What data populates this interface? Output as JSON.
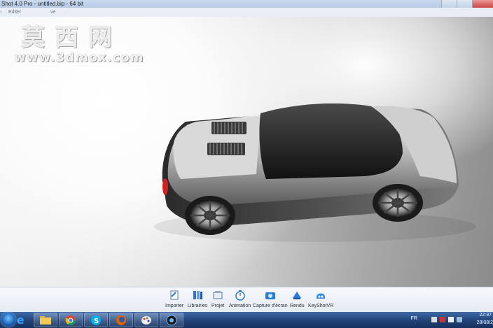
{
  "window": {
    "title": "Shot 4.0 Pro - untitled.bip - 64 bit"
  },
  "menu": {
    "items": [
      "Editer",
      "ve"
    ]
  },
  "watermark": {
    "chinese": "莫西网",
    "url": "www.3dmox.com"
  },
  "toolbar": {
    "items": [
      {
        "label": "Importer",
        "icon": "import-icon"
      },
      {
        "label": "Librairies",
        "icon": "library-icon"
      },
      {
        "label": "Projet",
        "icon": "project-icon"
      },
      {
        "label": "Animation",
        "icon": "animation-icon"
      },
      {
        "label": "Capture d'écran",
        "icon": "screenshot-icon"
      },
      {
        "label": "Rendu",
        "icon": "render-icon"
      },
      {
        "label": "KeyShotVR",
        "icon": "keyshotvr-icon"
      }
    ]
  },
  "taskbar": {
    "apps": [
      "ie-icon",
      "explorer-icon",
      "chrome-icon",
      "skype-icon",
      "firefox-icon",
      "paint-icon",
      "keyshot-icon"
    ],
    "language": "FR",
    "time": "22:37",
    "date": "28/08/2"
  },
  "colors": {
    "taskbar": "#1f3e72",
    "toolbar": "#eef2f7",
    "taillight": "#d42020"
  }
}
